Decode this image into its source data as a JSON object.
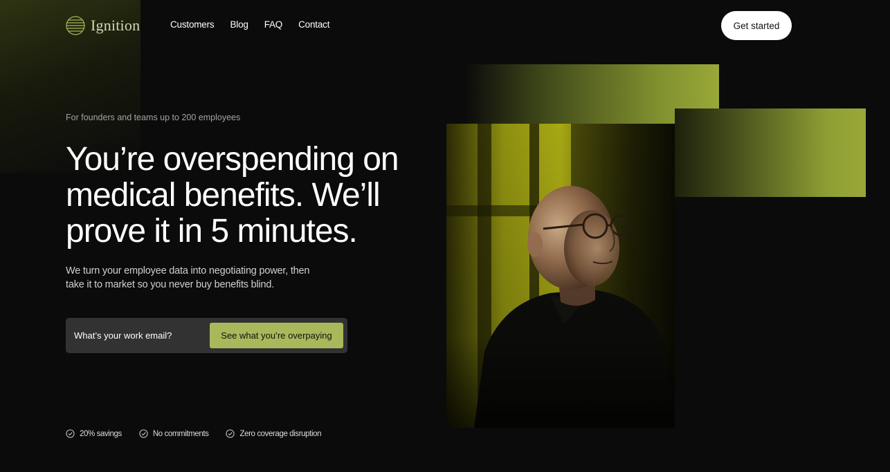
{
  "brand": {
    "name": "Ignition",
    "accent": "#a8b85a"
  },
  "nav": {
    "items": [
      {
        "label": "Customers"
      },
      {
        "label": "Blog"
      },
      {
        "label": "FAQ"
      },
      {
        "label": "Contact"
      }
    ],
    "cta_label": "Get started"
  },
  "hero": {
    "eyebrow": "For founders and teams up to 200 employees",
    "headline": "You’re overspending on medical benefits. We’ll prove it in 5 minutes.",
    "subtext": "We turn your employee data into negotiating power, then take it to market so you never buy benefits blind.",
    "email_placeholder": "What’s your work email?",
    "submit_label": "See what you’re overpaying"
  },
  "benefits": [
    {
      "icon": "check-circle-icon",
      "label": "20% savings"
    },
    {
      "icon": "check-circle-icon",
      "label": "No commitments"
    },
    {
      "icon": "check-circle-icon",
      "label": "Zero coverage disruption"
    }
  ]
}
